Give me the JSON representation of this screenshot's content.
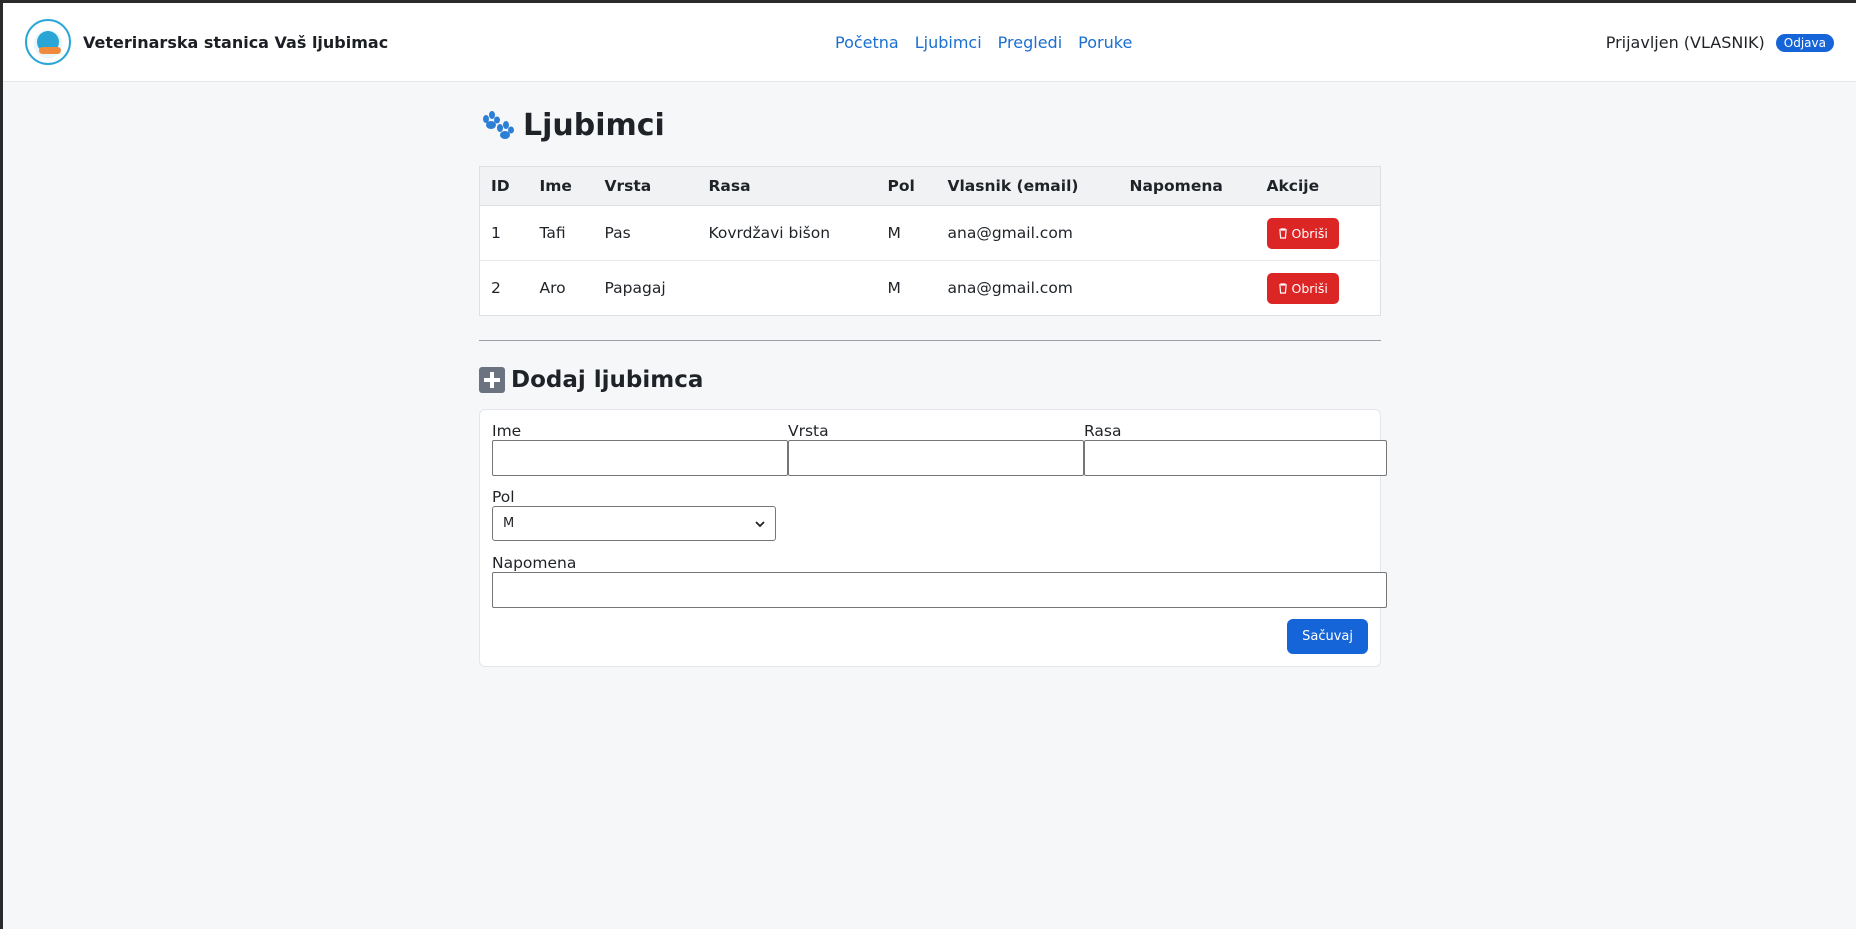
{
  "navbar": {
    "brand": "Veterinarska stanica Vaš ljubimac",
    "links": [
      "Početna",
      "Ljubimci",
      "Pregledi",
      "Poruke"
    ],
    "user_status": "Prijavljen (VLASNIK)",
    "logout": "Odjava"
  },
  "page": {
    "title": "Ljubimci"
  },
  "table": {
    "headers": [
      "ID",
      "Ime",
      "Vrsta",
      "Rasa",
      "Pol",
      "Vlasnik (email)",
      "Napomena",
      "Akcije"
    ],
    "rows": [
      {
        "id": "1",
        "ime": "Tafi",
        "vrsta": "Pas",
        "rasa": "Kovrdžavi bišon",
        "pol": "M",
        "vlasnik": "ana@gmail.com",
        "napomena": "",
        "action": "Obriši"
      },
      {
        "id": "2",
        "ime": "Aro",
        "vrsta": "Papagaj",
        "rasa": "",
        "pol": "M",
        "vlasnik": "ana@gmail.com",
        "napomena": "",
        "action": "Obriši"
      }
    ]
  },
  "form": {
    "title": "Dodaj ljubimca",
    "ime_label": "Ime",
    "vrsta_label": "Vrsta",
    "rasa_label": "Rasa",
    "pol_label": "Pol",
    "pol_value": "M",
    "napomena_label": "Napomena",
    "save": "Sačuvaj"
  },
  "colors": {
    "primary": "#1565d8",
    "danger": "#dc2626",
    "link": "#1a6fd1"
  }
}
